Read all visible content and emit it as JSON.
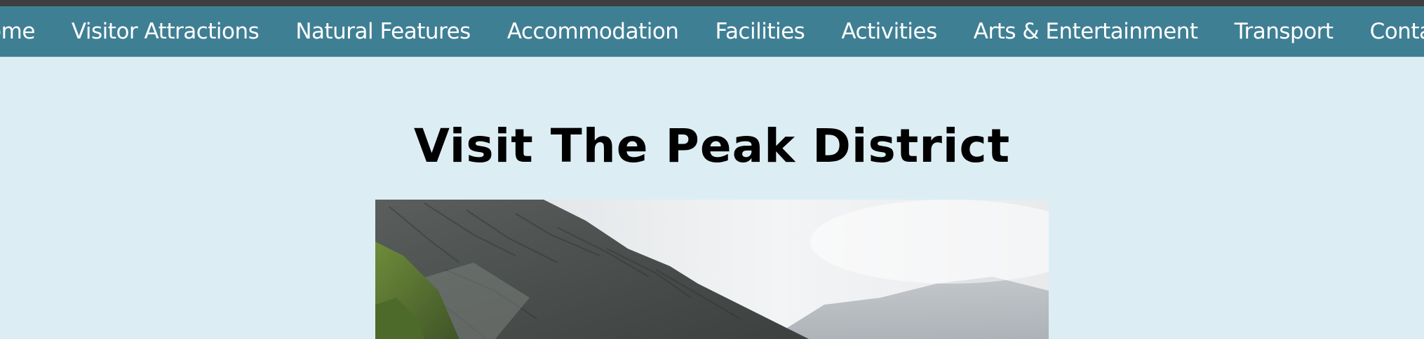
{
  "nav": {
    "items": [
      {
        "label": "Home",
        "name": "nav-home"
      },
      {
        "label": "Visitor Attractions",
        "name": "nav-visitor-attractions"
      },
      {
        "label": "Natural Features",
        "name": "nav-natural-features"
      },
      {
        "label": "Accommodation",
        "name": "nav-accommodation"
      },
      {
        "label": "Facilities",
        "name": "nav-facilities"
      },
      {
        "label": "Activities",
        "name": "nav-activities"
      },
      {
        "label": "Arts & Entertainment",
        "name": "nav-arts-entertainment"
      },
      {
        "label": "Transport",
        "name": "nav-transport"
      },
      {
        "label": "Contact",
        "name": "nav-contact"
      }
    ]
  },
  "page": {
    "title": "Visit The Peak District"
  },
  "colors": {
    "top_strip": "#3e3e40",
    "nav_bg": "#3f7f94",
    "page_bg": "#dceef4",
    "nav_text": "#ffffff",
    "title_text": "#000000"
  }
}
